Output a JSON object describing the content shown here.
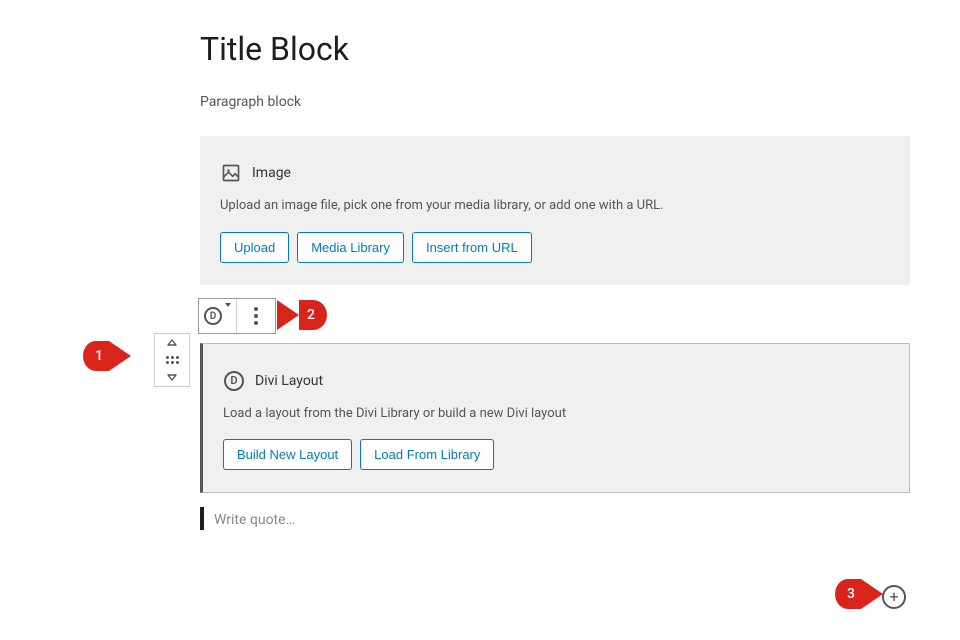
{
  "title": "Title Block",
  "paragraph": "Paragraph block",
  "image_block": {
    "title": "Image",
    "description": "Upload an image file, pick one from your media library, or add one with a URL.",
    "buttons": {
      "upload": "Upload",
      "media_library": "Media Library",
      "insert_url": "Insert from URL"
    }
  },
  "divi_block": {
    "title": "Divi Layout",
    "description": "Load a layout from the Divi Library or build a new Divi layout",
    "buttons": {
      "build": "Build New Layout",
      "load": "Load From Library"
    }
  },
  "quote": {
    "placeholder": "Write quote…"
  },
  "callouts": {
    "c1": "1",
    "c2": "2",
    "c3": "3"
  }
}
